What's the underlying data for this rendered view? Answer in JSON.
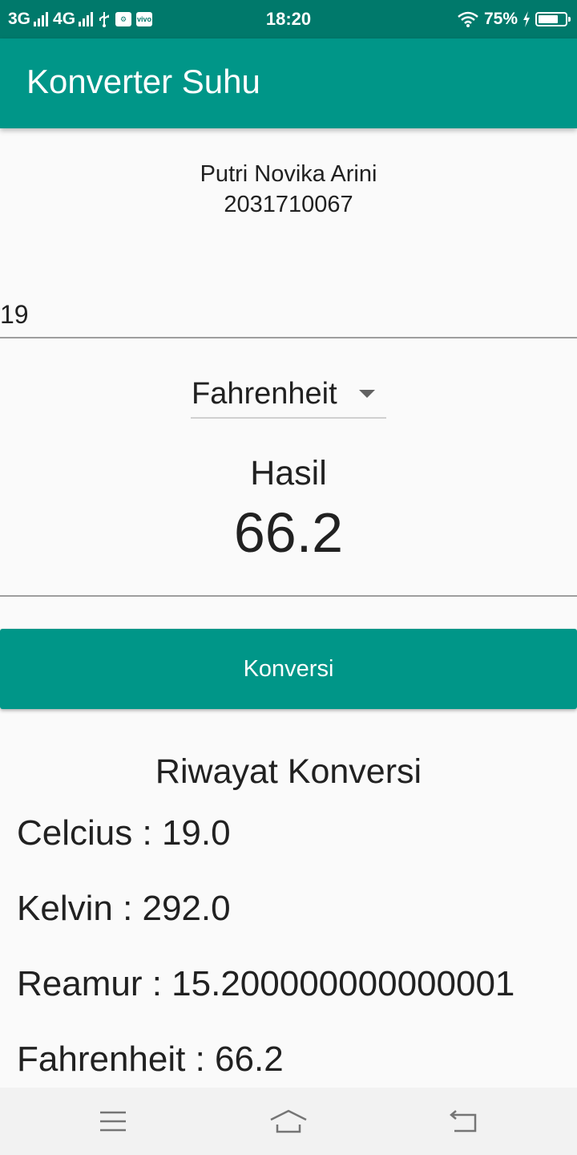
{
  "status_bar": {
    "network_left": "3G",
    "network_right": "4G",
    "time": "18:20",
    "battery_percent": "75%",
    "battery_level": 0.75,
    "icons": [
      "signal-icon",
      "signal-icon",
      "usb-icon",
      "notification-icon",
      "vivo-icon",
      "wifi-icon",
      "charging-icon",
      "battery-icon"
    ]
  },
  "app_bar": {
    "title": "Konverter Suhu"
  },
  "student": {
    "name": "Putri Novika Arini",
    "id": "2031710067"
  },
  "input": {
    "value": "19"
  },
  "dropdown": {
    "selected": "Fahrenheit"
  },
  "result": {
    "label": "Hasil",
    "value": "66.2"
  },
  "button": {
    "label": "Konversi"
  },
  "history": {
    "title": "Riwayat Konversi",
    "items": [
      "Celcius : 19.0",
      "Kelvin : 292.0",
      "Reamur : 15.200000000000001",
      "Fahrenheit : 66.2"
    ]
  },
  "nav_bar": {
    "icons": [
      "menu-icon",
      "home-icon",
      "back-icon"
    ]
  },
  "colors": {
    "primary": "#009688",
    "primary_dark": "#00796b",
    "text": "#212121",
    "background": "#fafafa"
  }
}
